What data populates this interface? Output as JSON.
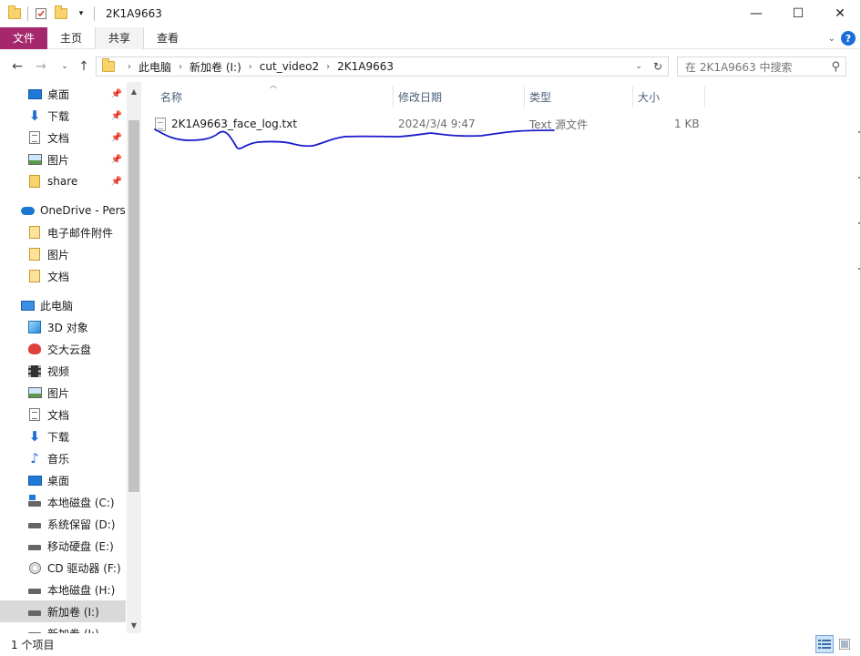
{
  "window": {
    "title": "2K1A9663",
    "controls": {
      "minimize": "—",
      "maximize": "☐",
      "close": "✕"
    }
  },
  "ribbon": {
    "tabs": [
      "文件",
      "主页",
      "共享",
      "查看"
    ],
    "active_tab": "共享",
    "file_tab_color": "#a5286d",
    "help_label": "?"
  },
  "address": {
    "crumbs": [
      "此电脑",
      "新加卷 (I:)",
      "cut_video2",
      "2K1A9663"
    ]
  },
  "search": {
    "placeholder": "在 2K1A9663 中搜索"
  },
  "nav_pane": {
    "quick_access": [
      {
        "label": "桌面",
        "icon": "desktop-icon",
        "pinned": true
      },
      {
        "label": "下载",
        "icon": "download-icon",
        "pinned": true
      },
      {
        "label": "文档",
        "icon": "document-icon",
        "pinned": true
      },
      {
        "label": "图片",
        "icon": "picture-icon",
        "pinned": true
      },
      {
        "label": "share",
        "icon": "folder-icon",
        "pinned": true
      }
    ],
    "onedrive": {
      "label": "OneDrive - Perso",
      "items": [
        "电子邮件附件",
        "图片",
        "文档"
      ]
    },
    "this_pc": {
      "label": "此电脑",
      "items": [
        {
          "label": "3D 对象",
          "icon": "3d-objects-icon"
        },
        {
          "label": "交大云盘",
          "icon": "cloud-drive-icon"
        },
        {
          "label": "视频",
          "icon": "video-icon"
        },
        {
          "label": "图片",
          "icon": "picture-icon"
        },
        {
          "label": "文档",
          "icon": "document-icon"
        },
        {
          "label": "下载",
          "icon": "download-icon"
        },
        {
          "label": "音乐",
          "icon": "music-icon"
        },
        {
          "label": "桌面",
          "icon": "desktop-icon"
        },
        {
          "label": "本地磁盘 (C:)",
          "icon": "system-drive-icon"
        },
        {
          "label": "系统保留 (D:)",
          "icon": "drive-icon"
        },
        {
          "label": "移动硬盘 (E:)",
          "icon": "drive-icon"
        },
        {
          "label": "CD 驱动器 (F:)",
          "icon": "cd-drive-icon"
        },
        {
          "label": "本地磁盘 (H:)",
          "icon": "drive-icon"
        },
        {
          "label": "新加卷 (I:)",
          "icon": "drive-icon",
          "selected": true
        },
        {
          "label": "新加卷 (J:)",
          "icon": "drive-icon"
        }
      ]
    }
  },
  "columns": {
    "name": "名称",
    "modified": "修改日期",
    "type": "类型",
    "size": "大小"
  },
  "files": [
    {
      "name": "2K1A9663_face_log.txt",
      "modified": "2024/3/4 9:47",
      "type": "Text 源文件",
      "size": "1 KB"
    }
  ],
  "annotation_color": "#1a1acc",
  "status": {
    "item_count": "1 个项目"
  }
}
